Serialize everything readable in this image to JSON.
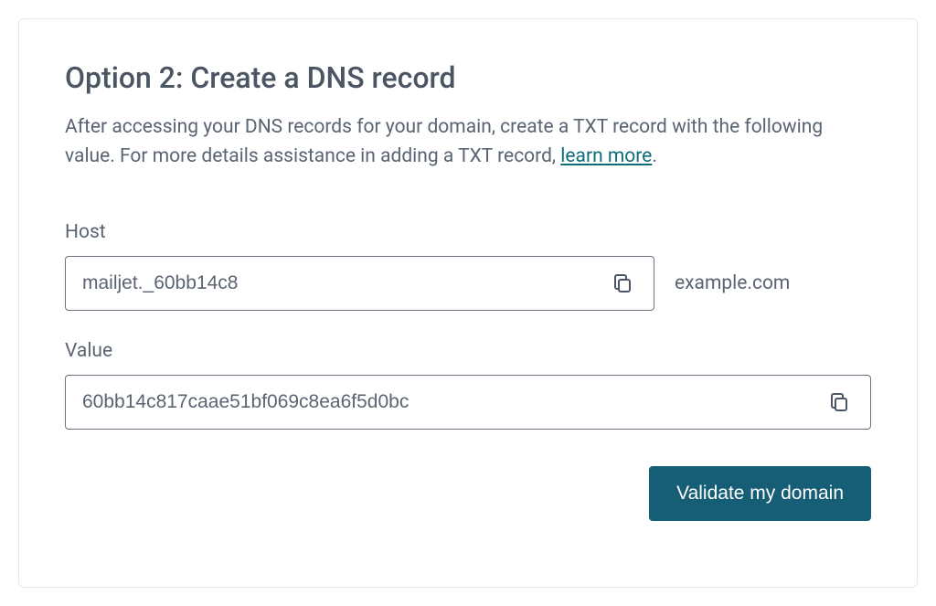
{
  "heading": "Option 2: Create a DNS record",
  "description_part1": "After accessing your DNS records for your domain, create a TXT record with the following value. For more details assistance in adding a TXT record, ",
  "description_link": "learn more",
  "description_part2": ".",
  "host": {
    "label": "Host",
    "value": "mailjet._60bb14c8",
    "domain_suffix": "example.com"
  },
  "value": {
    "label": "Value",
    "value": "60bb14c817caae51bf069c8ea6f5d0bc"
  },
  "actions": {
    "validate_label": "Validate my domain"
  }
}
